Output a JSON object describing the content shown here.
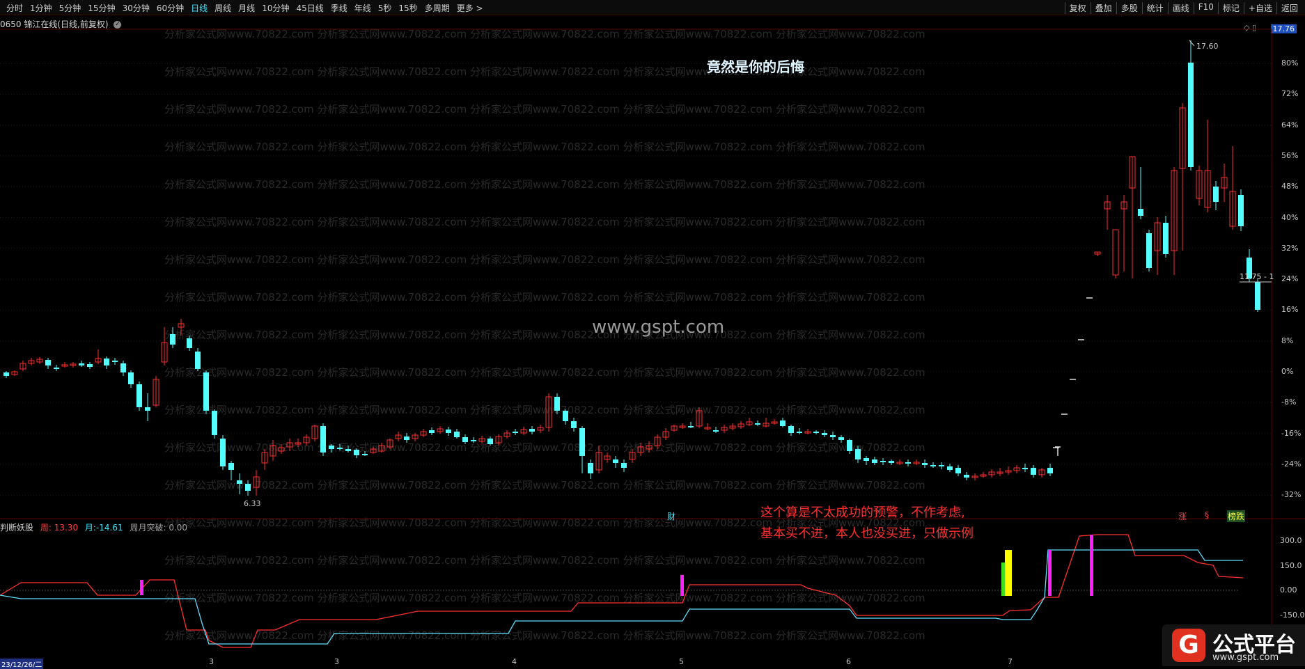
{
  "toolbar": {
    "periods": [
      "分时",
      "1分钟",
      "5分钟",
      "15分钟",
      "30分钟",
      "60分钟",
      "日线",
      "周线",
      "月线",
      "10分钟",
      "45日线",
      "季线",
      "年线",
      "5秒",
      "15秒",
      "多周期",
      "更多 >"
    ],
    "active_period": "日线",
    "right_items": [
      "复权",
      "叠加",
      "多股",
      "统计",
      "画线",
      "F10",
      "标记",
      "+自选",
      "返回"
    ]
  },
  "stock_title": "0650 锦江在线(日线,前复权)",
  "latest_price_tag": "17.76",
  "highlight_title": "竟然是你的后悔",
  "watermark_text": "分析家公式网www.70822.com",
  "site_watermark": "www.gspt.com",
  "main_axis_labels": [
    "80%",
    "72%",
    "64%",
    "56%",
    "48%",
    "40%",
    "32%",
    "24%",
    "16%",
    "8%",
    "0%",
    "-8%",
    "-16%",
    "-24%",
    "-32%"
  ],
  "high_label": "17.60",
  "low_label": "6.33",
  "current_price_label": "11.75 - 1",
  "caiwu_marker": "财",
  "tags": {
    "zhang": "涨",
    "s": "§",
    "bang": "榜跌"
  },
  "notes": [
    "这个算是不太成功的预警，不作考虑,",
    "基本买不进，本人也没买进，只做示例"
  ],
  "indicator": {
    "name": "判断妖股",
    "week_label": "周:",
    "week_value": "13.30",
    "month_label": "月:",
    "month_value": "-14.61",
    "break_label": "周月突破:",
    "break_value": "0.00"
  },
  "sub_axis_labels": [
    "300.0",
    "150.0",
    "0.00",
    "-150.0"
  ],
  "x_month_labels": [
    "3",
    "3",
    "4",
    "5",
    "6",
    "7"
  ],
  "bottom_date": "23/12/26/二",
  "logo": {
    "glyph": "G",
    "title": "公式平台",
    "url": "www.gspt.com"
  },
  "colors": {
    "up": "#ff3030",
    "down": "#54ffff",
    "accent": "#3fe8ff",
    "magenta": "#ff20ff",
    "yellow": "#ffff00",
    "green": "#40e020"
  }
}
